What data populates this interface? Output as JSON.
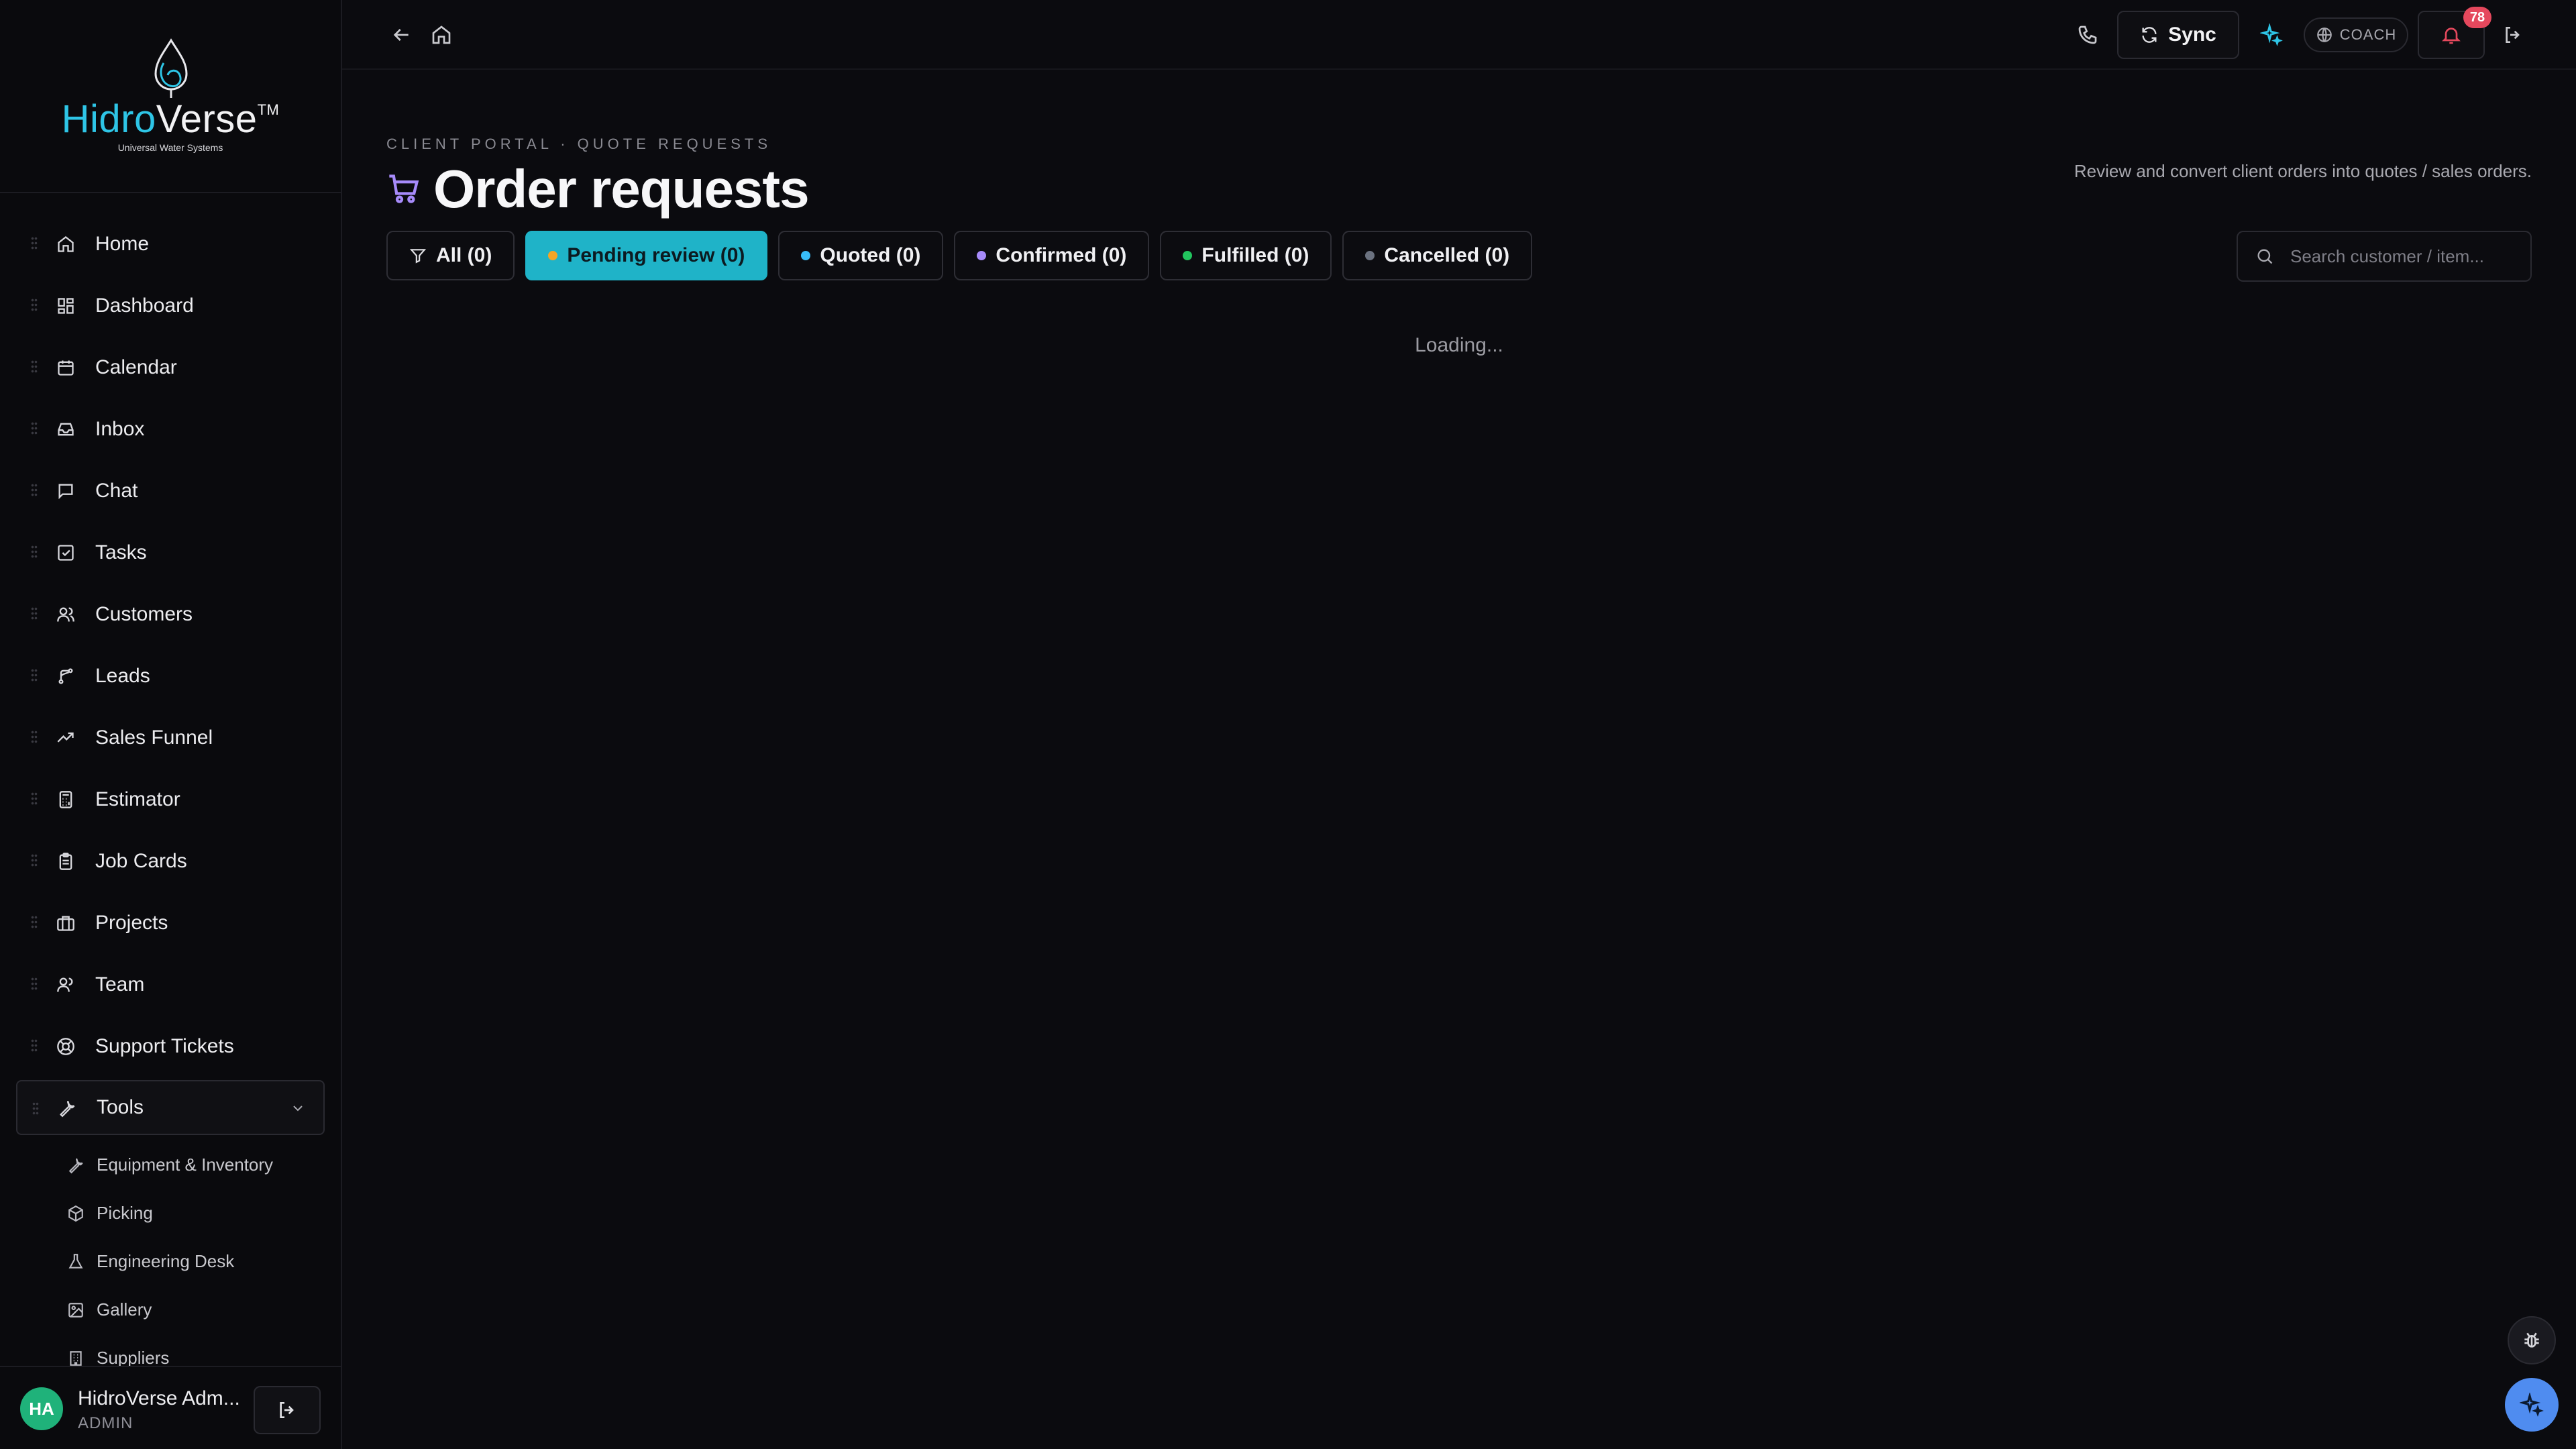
{
  "brand": {
    "name_part1": "Hidro",
    "name_part2": "Verse",
    "trademark": "TM",
    "tagline": "Universal Water Systems"
  },
  "sidebar": {
    "items": [
      {
        "label": "Home",
        "icon": "home-icon"
      },
      {
        "label": "Dashboard",
        "icon": "dashboard-icon"
      },
      {
        "label": "Calendar",
        "icon": "calendar-icon"
      },
      {
        "label": "Inbox",
        "icon": "inbox-icon"
      },
      {
        "label": "Chat",
        "icon": "chat-icon"
      },
      {
        "label": "Tasks",
        "icon": "tasks-icon"
      },
      {
        "label": "Customers",
        "icon": "customers-icon"
      },
      {
        "label": "Leads",
        "icon": "leads-icon"
      },
      {
        "label": "Sales Funnel",
        "icon": "trend-icon"
      },
      {
        "label": "Estimator",
        "icon": "calculator-icon"
      },
      {
        "label": "Job Cards",
        "icon": "clipboard-icon"
      },
      {
        "label": "Projects",
        "icon": "briefcase-icon"
      },
      {
        "label": "Team",
        "icon": "team-icon"
      },
      {
        "label": "Support Tickets",
        "icon": "lifebuoy-icon"
      }
    ],
    "tools": {
      "label": "Tools",
      "icon": "wrench-icon"
    },
    "sub_items": [
      {
        "label": "Equipment & Inventory",
        "icon": "wrench-icon"
      },
      {
        "label": "Picking",
        "icon": "package-icon"
      },
      {
        "label": "Engineering Desk",
        "icon": "flask-icon"
      },
      {
        "label": "Gallery",
        "icon": "image-icon"
      },
      {
        "label": "Suppliers",
        "icon": "building-icon"
      }
    ]
  },
  "user": {
    "initials": "HA",
    "name": "HidroVerse Adm...",
    "role": "ADMIN"
  },
  "topbar": {
    "sync_label": "Sync",
    "coach_label": "COACH",
    "notification_count": "78"
  },
  "page": {
    "breadcrumb": "CLIENT PORTAL · QUOTE REQUESTS",
    "title": "Order requests",
    "subtitle": "Review and convert client orders into quotes / sales orders.",
    "search_placeholder": "Search customer / item...",
    "loading_text": "Loading..."
  },
  "filters": [
    {
      "label": "All (0)",
      "dot": null,
      "active": false
    },
    {
      "label": "Pending review (0)",
      "dot": "#f5a524",
      "active": true
    },
    {
      "label": "Quoted (0)",
      "dot": "#38bdf8",
      "active": false
    },
    {
      "label": "Confirmed (0)",
      "dot": "#a78bfa",
      "active": false
    },
    {
      "label": "Fulfilled (0)",
      "dot": "#22c55e",
      "active": false
    },
    {
      "label": "Cancelled (0)",
      "dot": "#6b7280",
      "active": false
    }
  ],
  "colors": {
    "accent": "#1fb3c8",
    "brand_cyan": "#2ec5e6",
    "badge": "#e5485d",
    "cart": "#a78bfa"
  }
}
